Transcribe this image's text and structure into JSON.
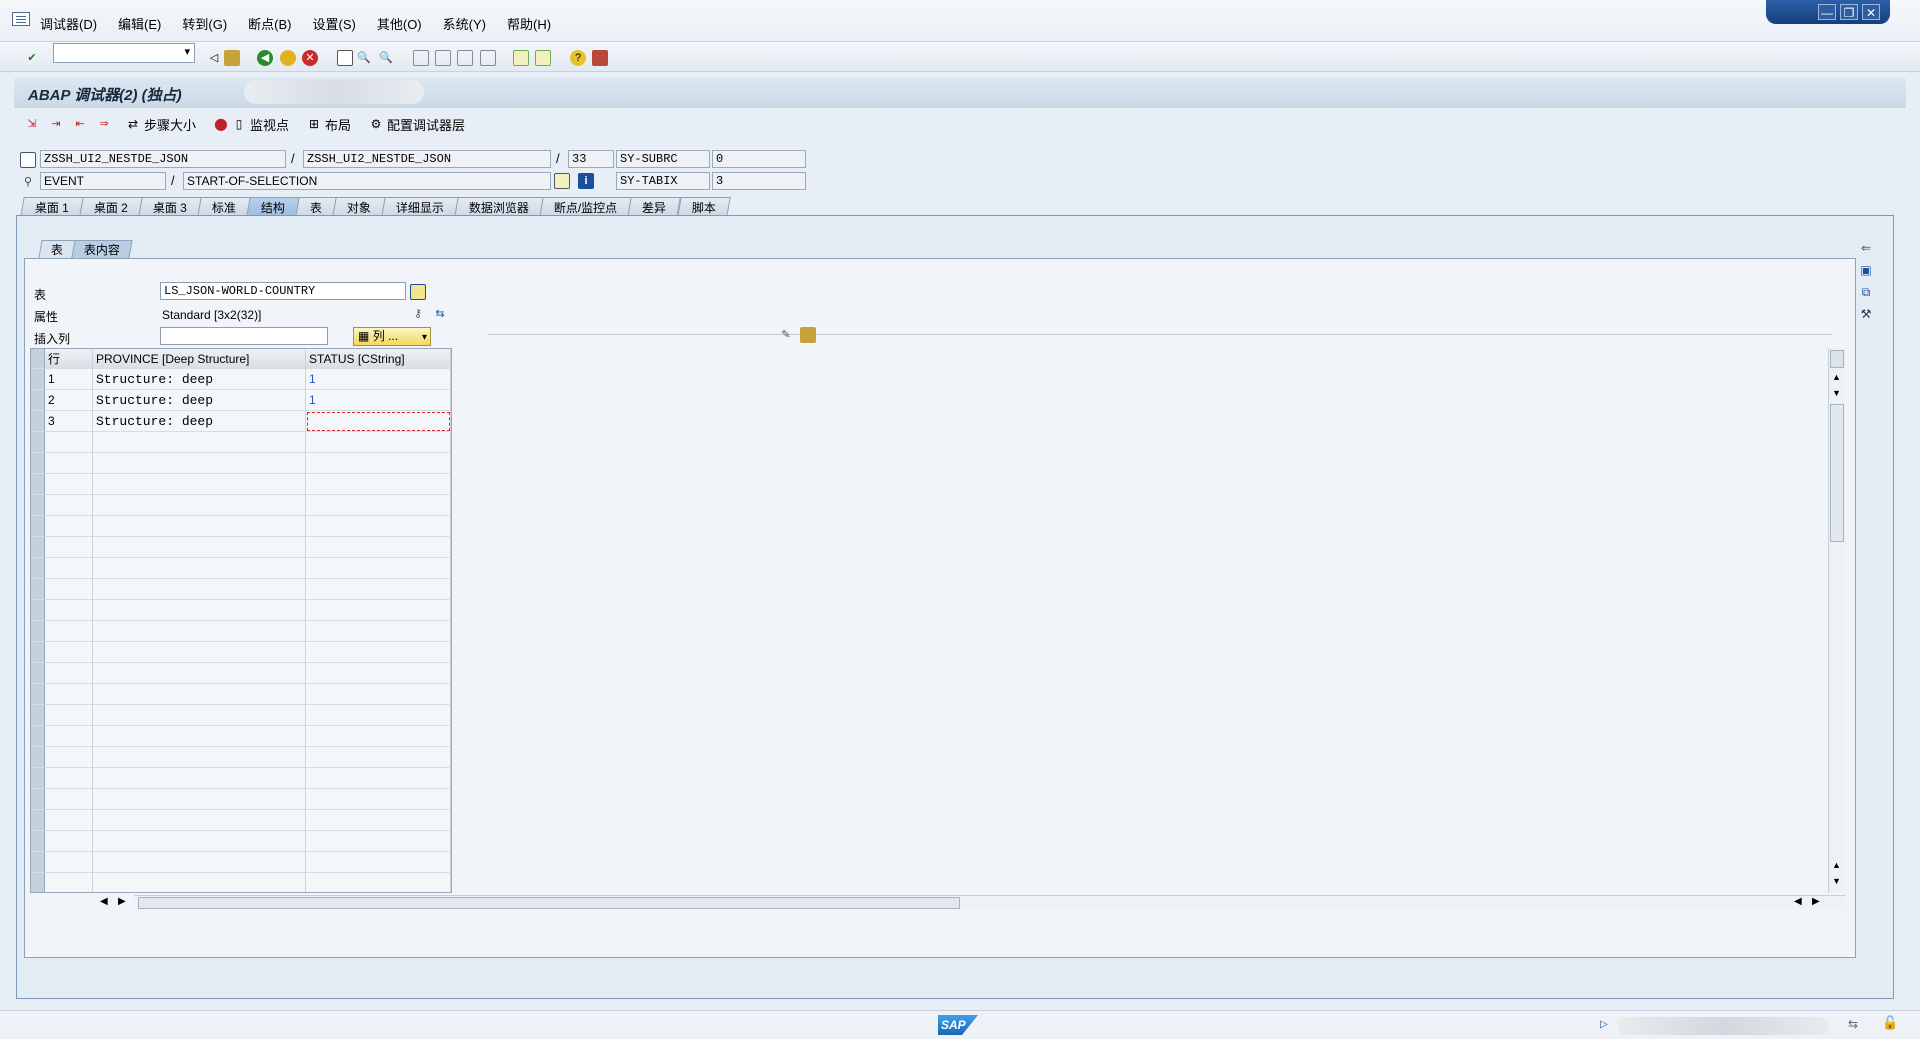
{
  "menu": [
    "调试器(D)",
    "编辑(E)",
    "转到(G)",
    "断点(B)",
    "设置(S)",
    "其他(O)",
    "系统(Y)",
    "帮助(H)"
  ],
  "window_controls": [
    "—",
    "❐",
    "✕"
  ],
  "title": "ABAP 调试器(2) (独占)",
  "app_toolbar": {
    "step_size": "步骤大小",
    "watchpoint": "监视点",
    "layout": "布局",
    "configure_layer": "配置调试器层"
  },
  "context": {
    "program1": "ZSSH_UI2_NESTDE_JSON",
    "program2": "ZSSH_UI2_NESTDE_JSON",
    "line": "33",
    "sy_subrc_label": "SY-SUBRC",
    "sy_subrc_value": "0",
    "event_type": "EVENT",
    "event_name": "START-OF-SELECTION",
    "sy_tabix_label": "SY-TABIX",
    "sy_tabix_value": "3"
  },
  "tabs": [
    "桌面 1",
    "桌面 2",
    "桌面 3",
    "标准",
    "结构",
    "表",
    "对象",
    "详细显示",
    "数据浏览器",
    "断点/监控点",
    "差异",
    "脚本"
  ],
  "active_tab": "结构",
  "subtabs": [
    "表",
    "表内容"
  ],
  "table_form": {
    "table_label": "表",
    "table_value": "LS_JSON-WORLD-COUNTRY",
    "attr_label": "属性",
    "attr_value": "Standard [3x2(32)]",
    "insert_col_label": "插入列",
    "insert_col_value": "",
    "columns_button": "列 ..."
  },
  "grid": {
    "headers": [
      "行",
      "PROVINCE [Deep Structure]",
      "STATUS [CString]"
    ],
    "rows": [
      {
        "row": "1",
        "province": "Structure: deep",
        "status": "1"
      },
      {
        "row": "2",
        "province": "Structure: deep",
        "status": "1"
      },
      {
        "row": "3",
        "province": "Structure: deep",
        "status": ""
      }
    ]
  },
  "status_logo": "SAP"
}
